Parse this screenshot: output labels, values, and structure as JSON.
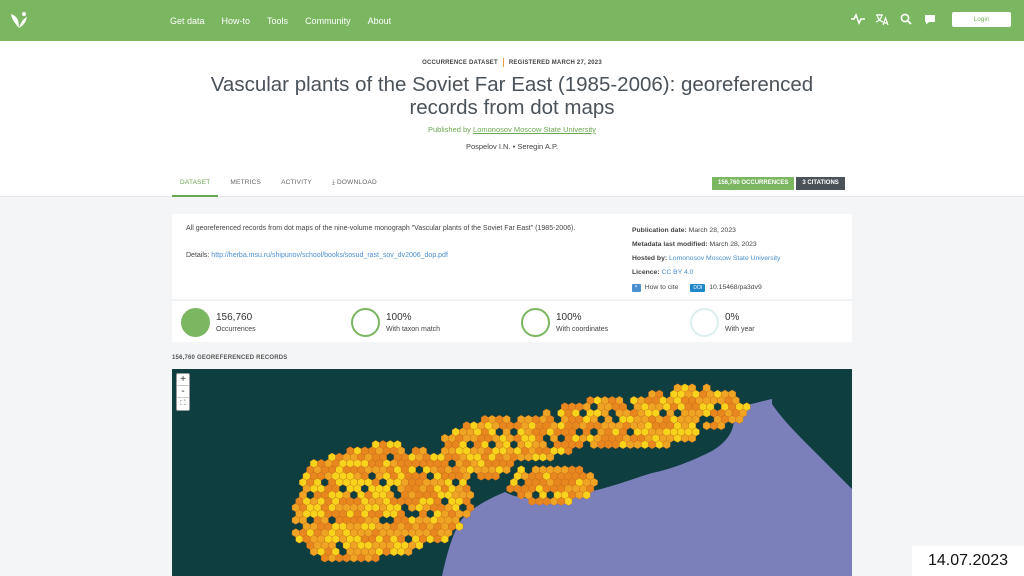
{
  "nav": {
    "links": [
      "Get data",
      "How-to",
      "Tools",
      "Community",
      "About"
    ],
    "login_label": "Login",
    "icons": [
      "leaf-logo-icon",
      "activity-icon",
      "translate-icon",
      "search-icon",
      "chat-icon"
    ]
  },
  "header": {
    "type_label": "OCCURRENCE DATASET",
    "registered_label": "REGISTERED MARCH 27, 2023",
    "title": "Vascular plants of the Soviet Far East (1985-2006): georeferenced records from dot maps",
    "published_by_label": "Published by",
    "publisher": "Lomonosov Moscow State University",
    "authors": "Pospelov I.N. • Seregin A.P."
  },
  "tabs": [
    {
      "label": "DATASET",
      "active": true
    },
    {
      "label": "METRICS",
      "active": false
    },
    {
      "label": "ACTIVITY",
      "active": false
    },
    {
      "label": "DOWNLOAD",
      "active": false
    }
  ],
  "badges": {
    "occurrences": "156,760 OCCURRENCES",
    "citations": "3 CITATIONS"
  },
  "summary": {
    "description": "All georeferenced records from dot maps of the nine-volume monograph \"Vascular plants of the Soviet Far East\" (1985-2006).",
    "details_label": "Details:",
    "details_url": "http://herba.msu.ru/shipunov/school/books/sosud_rast_sov_dv2006_dop.pdf"
  },
  "side_info": {
    "publication_label": "Publication date:",
    "publication_value": "March 28, 2023",
    "modified_label": "Metadata last modified:",
    "modified_value": "March 28, 2023",
    "hosted_label": "Hosted by:",
    "hosted_value": "Lomonosov Moscow State University",
    "licence_label": "Licence:",
    "licence_value": "CC BY 4.0",
    "cite_label": "How to cite",
    "doi_label": "DOI",
    "doi_value": "10.15468/pa3dv9"
  },
  "stats": [
    {
      "value": "156,760",
      "label": "Occurrences",
      "fraction": 1.0
    },
    {
      "value": "100%",
      "label": "With taxon match",
      "fraction": 1.0
    },
    {
      "value": "100%",
      "label": "With coordinates",
      "fraction": 1.0
    },
    {
      "value": "0%",
      "label": "With year",
      "fraction": 0.0
    }
  ],
  "map": {
    "section_label": "156,760 GEOREFERENCED RECORDS",
    "zoom_in": "+",
    "zoom_out": "-",
    "fullscreen": "⛶",
    "colors": {
      "ocean": "#7b7fba",
      "land": "#0f3e40",
      "hex_high": "#e8871e",
      "hex_low": "#f7d31c"
    }
  },
  "date_stamp": "14.07.2023"
}
